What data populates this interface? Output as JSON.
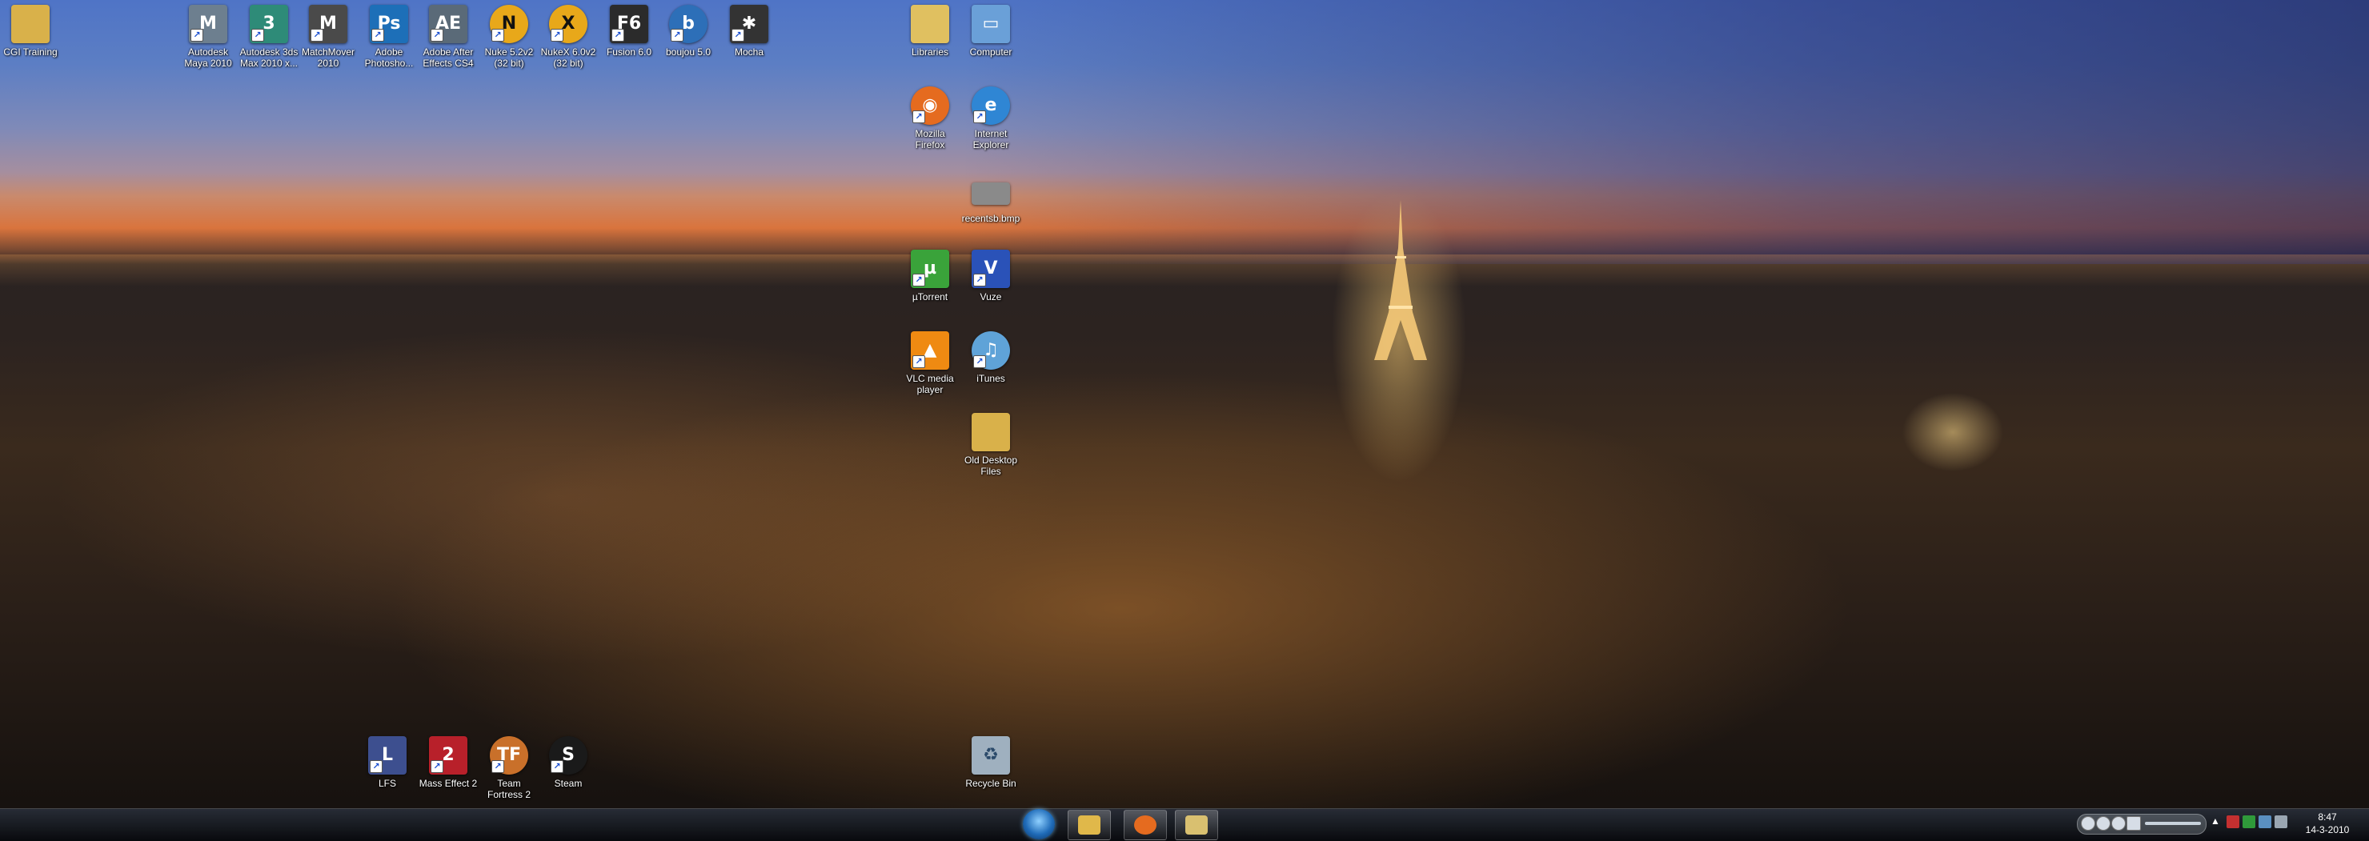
{
  "desktop": {
    "icons": [
      {
        "label": "CGI Training",
        "icon": "folder-icon",
        "color": "#d9b14a",
        "glyph": ""
      },
      {
        "label": "Autodesk Maya 2010",
        "icon": "maya-icon",
        "color": "#6d7f8f",
        "glyph": "M"
      },
      {
        "label": "Autodesk 3ds Max 2010 x...",
        "icon": "3dsmax-icon",
        "color": "#2e8b78",
        "glyph": "3"
      },
      {
        "label": "MatchMover 2010",
        "icon": "matchmover-icon",
        "color": "#4a4a4a",
        "glyph": "M"
      },
      {
        "label": "Adobe Photosho...",
        "icon": "photoshop-icon",
        "color": "#1d6fb8",
        "glyph": "Ps"
      },
      {
        "label": "Adobe After Effects CS4",
        "icon": "after-effects-icon",
        "color": "#5a6a78",
        "glyph": "AE"
      },
      {
        "label": "Nuke 5.2v2 (32 bit)",
        "icon": "nuke-icon",
        "color": "#e8a81a",
        "glyph": "N"
      },
      {
        "label": "NukeX 6.0v2 (32 bit)",
        "icon": "nukex-icon",
        "color": "#e8a81a",
        "glyph": "X"
      },
      {
        "label": "Fusion 6.0",
        "icon": "fusion-icon",
        "color": "#2b2b2b",
        "glyph": "F6"
      },
      {
        "label": "boujou 5.0",
        "icon": "boujou-icon",
        "color": "#2d6fb8",
        "glyph": "b"
      },
      {
        "label": "Mocha",
        "icon": "mocha-icon",
        "color": "#333333",
        "glyph": "✱"
      },
      {
        "label": "Libraries",
        "icon": "libraries-icon",
        "color": "#e0c060",
        "glyph": ""
      },
      {
        "label": "Computer",
        "icon": "computer-icon",
        "color": "#6aa0d8",
        "glyph": "▭"
      },
      {
        "label": "Mozilla Firefox",
        "icon": "firefox-icon",
        "color": "#e56b1f",
        "glyph": "◉"
      },
      {
        "label": "Internet Explorer",
        "icon": "internet-explorer-icon",
        "color": "#2f86d4",
        "glyph": "e"
      },
      {
        "label": "recentsb.bmp",
        "icon": "image-file-icon",
        "color": "#8a8a8a",
        "glyph": ""
      },
      {
        "label": "µTorrent",
        "icon": "utorrent-icon",
        "color": "#3aa33a",
        "glyph": "µ"
      },
      {
        "label": "Vuze",
        "icon": "vuze-icon",
        "color": "#2a52b8",
        "glyph": "V"
      },
      {
        "label": "VLC media player",
        "icon": "vlc-icon",
        "color": "#ef8a12",
        "glyph": "▲"
      },
      {
        "label": "iTunes",
        "icon": "itunes-icon",
        "color": "#5fa3d8",
        "glyph": "♫"
      },
      {
        "label": "Old Desktop Files",
        "icon": "folder-icon",
        "color": "#d9b14a",
        "glyph": ""
      },
      {
        "label": "LFS",
        "icon": "lfs-icon",
        "color": "#3d4f8f",
        "glyph": "L"
      },
      {
        "label": "Mass Effect 2",
        "icon": "mass-effect-2-icon",
        "color": "#b8202a",
        "glyph": "2"
      },
      {
        "label": "Team Fortress 2",
        "icon": "team-fortress-2-icon",
        "color": "#c9702a",
        "glyph": "TF"
      },
      {
        "label": "Steam",
        "icon": "steam-icon",
        "color": "#1a1a1a",
        "glyph": "S"
      },
      {
        "label": "Recycle Bin",
        "icon": "recycle-bin-icon",
        "color": "#9fb0bf",
        "glyph": "♻"
      }
    ]
  },
  "taskbar": {
    "pinned": [
      {
        "icon": "windows-explorer-icon",
        "color": "#e0b84a"
      },
      {
        "icon": "firefox-icon",
        "color": "#e56b1f"
      },
      {
        "icon": "libraries-icon",
        "color": "#d9c070"
      }
    ],
    "clock": {
      "time": "8:47",
      "date": "14-3-2010"
    }
  }
}
